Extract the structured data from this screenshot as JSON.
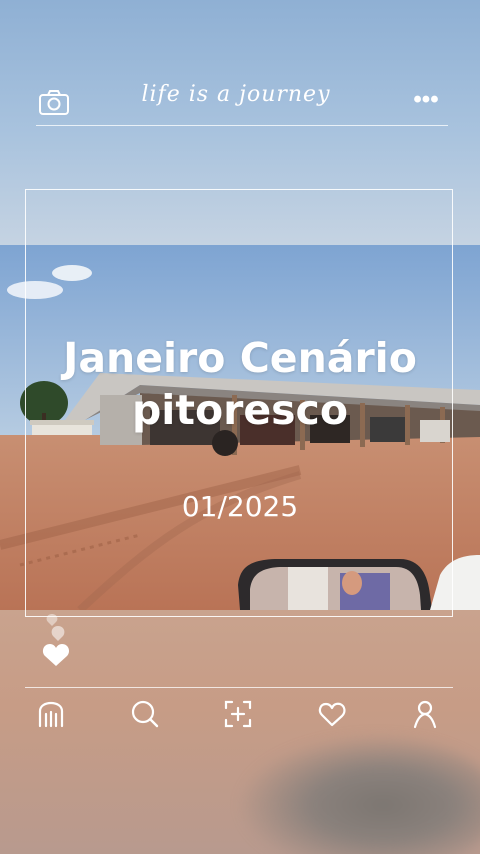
{
  "header": {
    "title": "life is a journey",
    "camera_icon": "camera-icon",
    "more_icon": "more-dots-icon",
    "more_glyph": "•••"
  },
  "main": {
    "headline_line1": "Janeiro Cenário",
    "headline_line2": "pitoresco",
    "date": "01/2025"
  },
  "nav": {
    "items": [
      {
        "icon": "home-icon"
      },
      {
        "icon": "search-icon"
      },
      {
        "icon": "add-frame-icon"
      },
      {
        "icon": "heart-icon"
      },
      {
        "icon": "profile-icon"
      }
    ]
  },
  "colors": {
    "text": "#ffffff",
    "sky": "#9db9d8",
    "ground": "#c2876a"
  }
}
